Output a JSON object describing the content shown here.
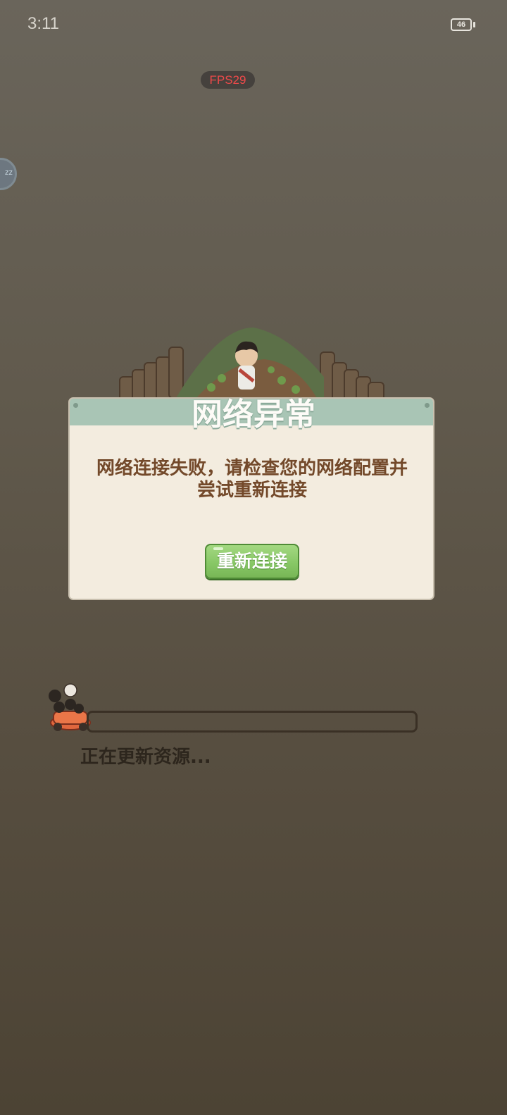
{
  "status_bar": {
    "time": "3:11",
    "battery_level": "46"
  },
  "overlay": {
    "fps": "FPS29"
  },
  "dialog": {
    "title": "网络异常",
    "message": "网络连接失败，请检查您的网络配置并尝试重新连接",
    "button_label": "重新连接"
  },
  "loading": {
    "progress": 0,
    "text": "正在更新资源..."
  },
  "colors": {
    "dialog_background": "#f3ecdf",
    "dialog_header": "#a9c5b5",
    "button_green": "#86c664",
    "fps_text": "#ef4a4a"
  }
}
